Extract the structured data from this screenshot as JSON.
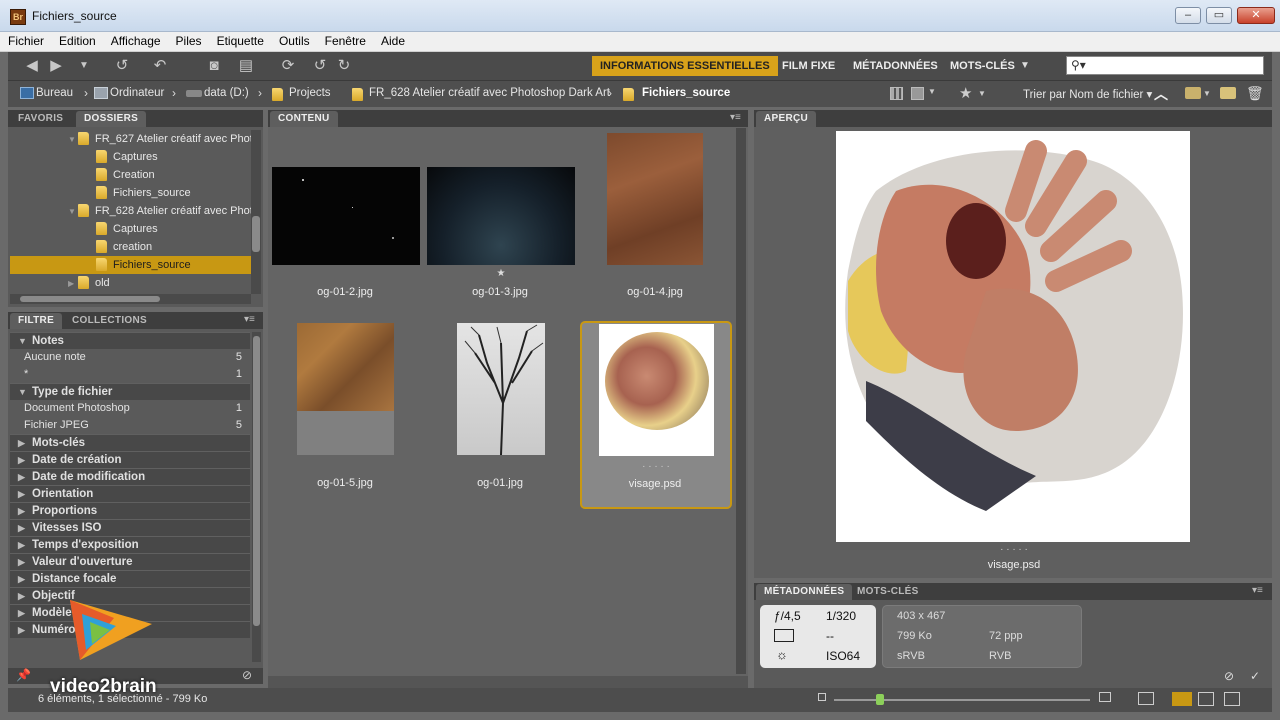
{
  "window": {
    "title": "Fichiers_source",
    "app_icon": "Br"
  },
  "menu": [
    "Fichier",
    "Edition",
    "Affichage",
    "Piles",
    "Etiquette",
    "Outils",
    "Fenêtre",
    "Aide"
  ],
  "workspaces": [
    {
      "label": "INFORMATIONS ESSENTIELLES",
      "active": true
    },
    {
      "label": "FILM FIXE",
      "active": false
    },
    {
      "label": "MÉTADONNÉES",
      "active": false
    },
    {
      "label": "MOTS-CLÉS",
      "active": false
    }
  ],
  "search": {
    "value": ""
  },
  "path": [
    "Bureau",
    "Ordinateur",
    "data (D:)",
    "Projects",
    "FR_628 Atelier créatif avec Photoshop  Dark Art",
    "Fichiers_source"
  ],
  "sort_label": "Trier par Nom de fichier",
  "panels": {
    "favorites_tab": "FAVORIS",
    "folders_tab": "DOSSIERS",
    "content_tab": "CONTENU",
    "preview_tab": "APERÇU",
    "filter_tab": "FILTRE",
    "collections_tab": "COLLECTIONS",
    "metadata_tab": "MÉTADONNÉES",
    "keywords_tab": "MOTS-CLÉS"
  },
  "folders": [
    {
      "label": "FR_627 Atelier créatif avec Photoshop",
      "level": 1
    },
    {
      "label": "Captures",
      "level": 2
    },
    {
      "label": "Creation",
      "level": 2
    },
    {
      "label": "Fichiers_source",
      "level": 2
    },
    {
      "label": "FR_628 Atelier créatif avec Photoshop",
      "level": 1
    },
    {
      "label": "Captures",
      "level": 2
    },
    {
      "label": "creation",
      "level": 2
    },
    {
      "label": "Fichiers_source",
      "level": 2,
      "selected": true
    },
    {
      "label": "old",
      "level": 1
    }
  ],
  "filters": {
    "notes": {
      "title": "Notes",
      "items": [
        {
          "label": "Aucune note",
          "count": "5"
        },
        {
          "label": "*",
          "count": "1"
        }
      ]
    },
    "filetype": {
      "title": "Type de fichier",
      "items": [
        {
          "label": "Document Photoshop",
          "count": "1"
        },
        {
          "label": "Fichier JPEG",
          "count": "5"
        }
      ]
    },
    "groups": [
      "Mots-clés",
      "Date de création",
      "Date de modification",
      "Orientation",
      "Proportions",
      "Vitesses ISO",
      "Temps d'exposition",
      "Valeur d'ouverture",
      "Distance focale",
      "Objectif",
      "Modèle",
      "Numéro de série"
    ]
  },
  "thumbnails": [
    {
      "name": "og-01-2.jpg",
      "rating": ""
    },
    {
      "name": "og-01-3.jpg",
      "rating": "★"
    },
    {
      "name": "og-01-4.jpg",
      "rating": ""
    },
    {
      "name": "og-01-5.jpg",
      "rating": ""
    },
    {
      "name": "og-01.jpg",
      "rating": ""
    },
    {
      "name": "visage.psd",
      "rating": "· · · · ·",
      "selected": true
    }
  ],
  "preview": {
    "caption": "visage.psd",
    "dots": "· · · · ·"
  },
  "metadata": {
    "aperture": "ƒ/4,5",
    "shutter": "1/320",
    "metering": "--",
    "iso": "ISO64",
    "dimensions": "403 x 467",
    "size": "799 Ko",
    "resolution": "72 ppp",
    "profile": "sRVB",
    "mode": "RVB"
  },
  "status": "6 éléments, 1 sélectionné - 799 Ko",
  "watermark": "video2brain"
}
